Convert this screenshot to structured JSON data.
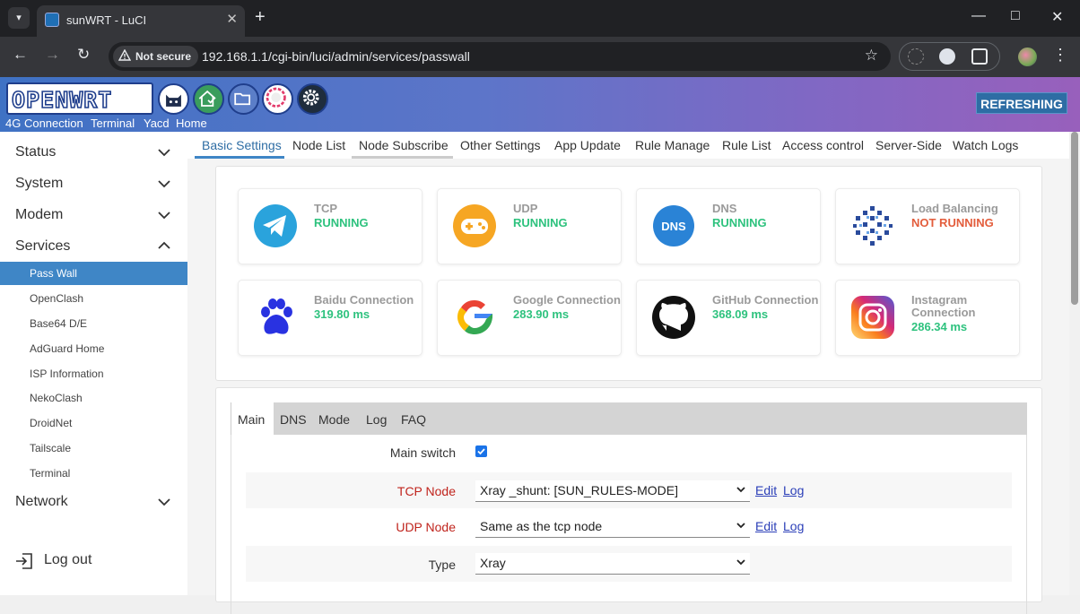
{
  "browser": {
    "tab_title": "sunWRT - LuCI",
    "not_secure": "Not secure",
    "url": "192.168.1.1/cgi-bin/luci/admin/services/passwall"
  },
  "header": {
    "logo": "OPENWRT",
    "shortcuts": [
      "4G Connection",
      "Terminal",
      "Yacd",
      "Home"
    ],
    "refreshing": "REFRESHING"
  },
  "sidebar": {
    "groups": {
      "status": "Status",
      "system": "System",
      "modem": "Modem",
      "services": "Services",
      "network": "Network"
    },
    "services_items": [
      "Pass Wall",
      "OpenClash",
      "Base64 D/E",
      "AdGuard Home",
      "ISP Information",
      "NekoClash",
      "DroidNet",
      "Tailscale",
      "Terminal"
    ],
    "logout": "Log out"
  },
  "tabs": [
    "Basic Settings",
    "Node List",
    "Node Subscribe",
    "Other Settings",
    "App Update",
    "Rule Manage",
    "Rule List",
    "Access control",
    "Server-Side",
    "Watch Logs"
  ],
  "status_cards": [
    {
      "title": "TCP",
      "value": "RUNNING",
      "icon": "telegram-icon"
    },
    {
      "title": "UDP",
      "value": "RUNNING",
      "icon": "gamepad-icon"
    },
    {
      "title": "DNS",
      "value": "RUNNING",
      "icon": "dns-icon"
    },
    {
      "title": "Load Balancing",
      "value": "NOT RUNNING",
      "icon": "load-balancing-icon"
    },
    {
      "title": "Baidu Connection",
      "value": "319.80 ms",
      "icon": "baidu-paw-icon"
    },
    {
      "title": "Google Connection",
      "value": "283.90 ms",
      "icon": "google-icon"
    },
    {
      "title": "GitHub Connection",
      "value": "368.09 ms",
      "icon": "github-icon"
    },
    {
      "title": "Instagram Connection",
      "value": "286.34 ms",
      "icon": "instagram-icon"
    }
  ],
  "config": {
    "tabs": [
      "Main",
      "DNS",
      "Mode",
      "Log",
      "FAQ"
    ],
    "main_switch_label": "Main switch",
    "main_switch_checked": true,
    "tcp_node_label": "TCP Node",
    "tcp_node_value": "Xray _shunt:  [SUN_RULES-MODE]",
    "udp_node_label": "UDP Node",
    "udp_node_value": "Same as the tcp node",
    "type_label": "Type",
    "type_value": "Xray",
    "edit": "Edit",
    "log": "Log"
  },
  "colors": {
    "accent": "#3f86c6",
    "running": "#2ec27e",
    "not_running": "#e35d3c"
  }
}
